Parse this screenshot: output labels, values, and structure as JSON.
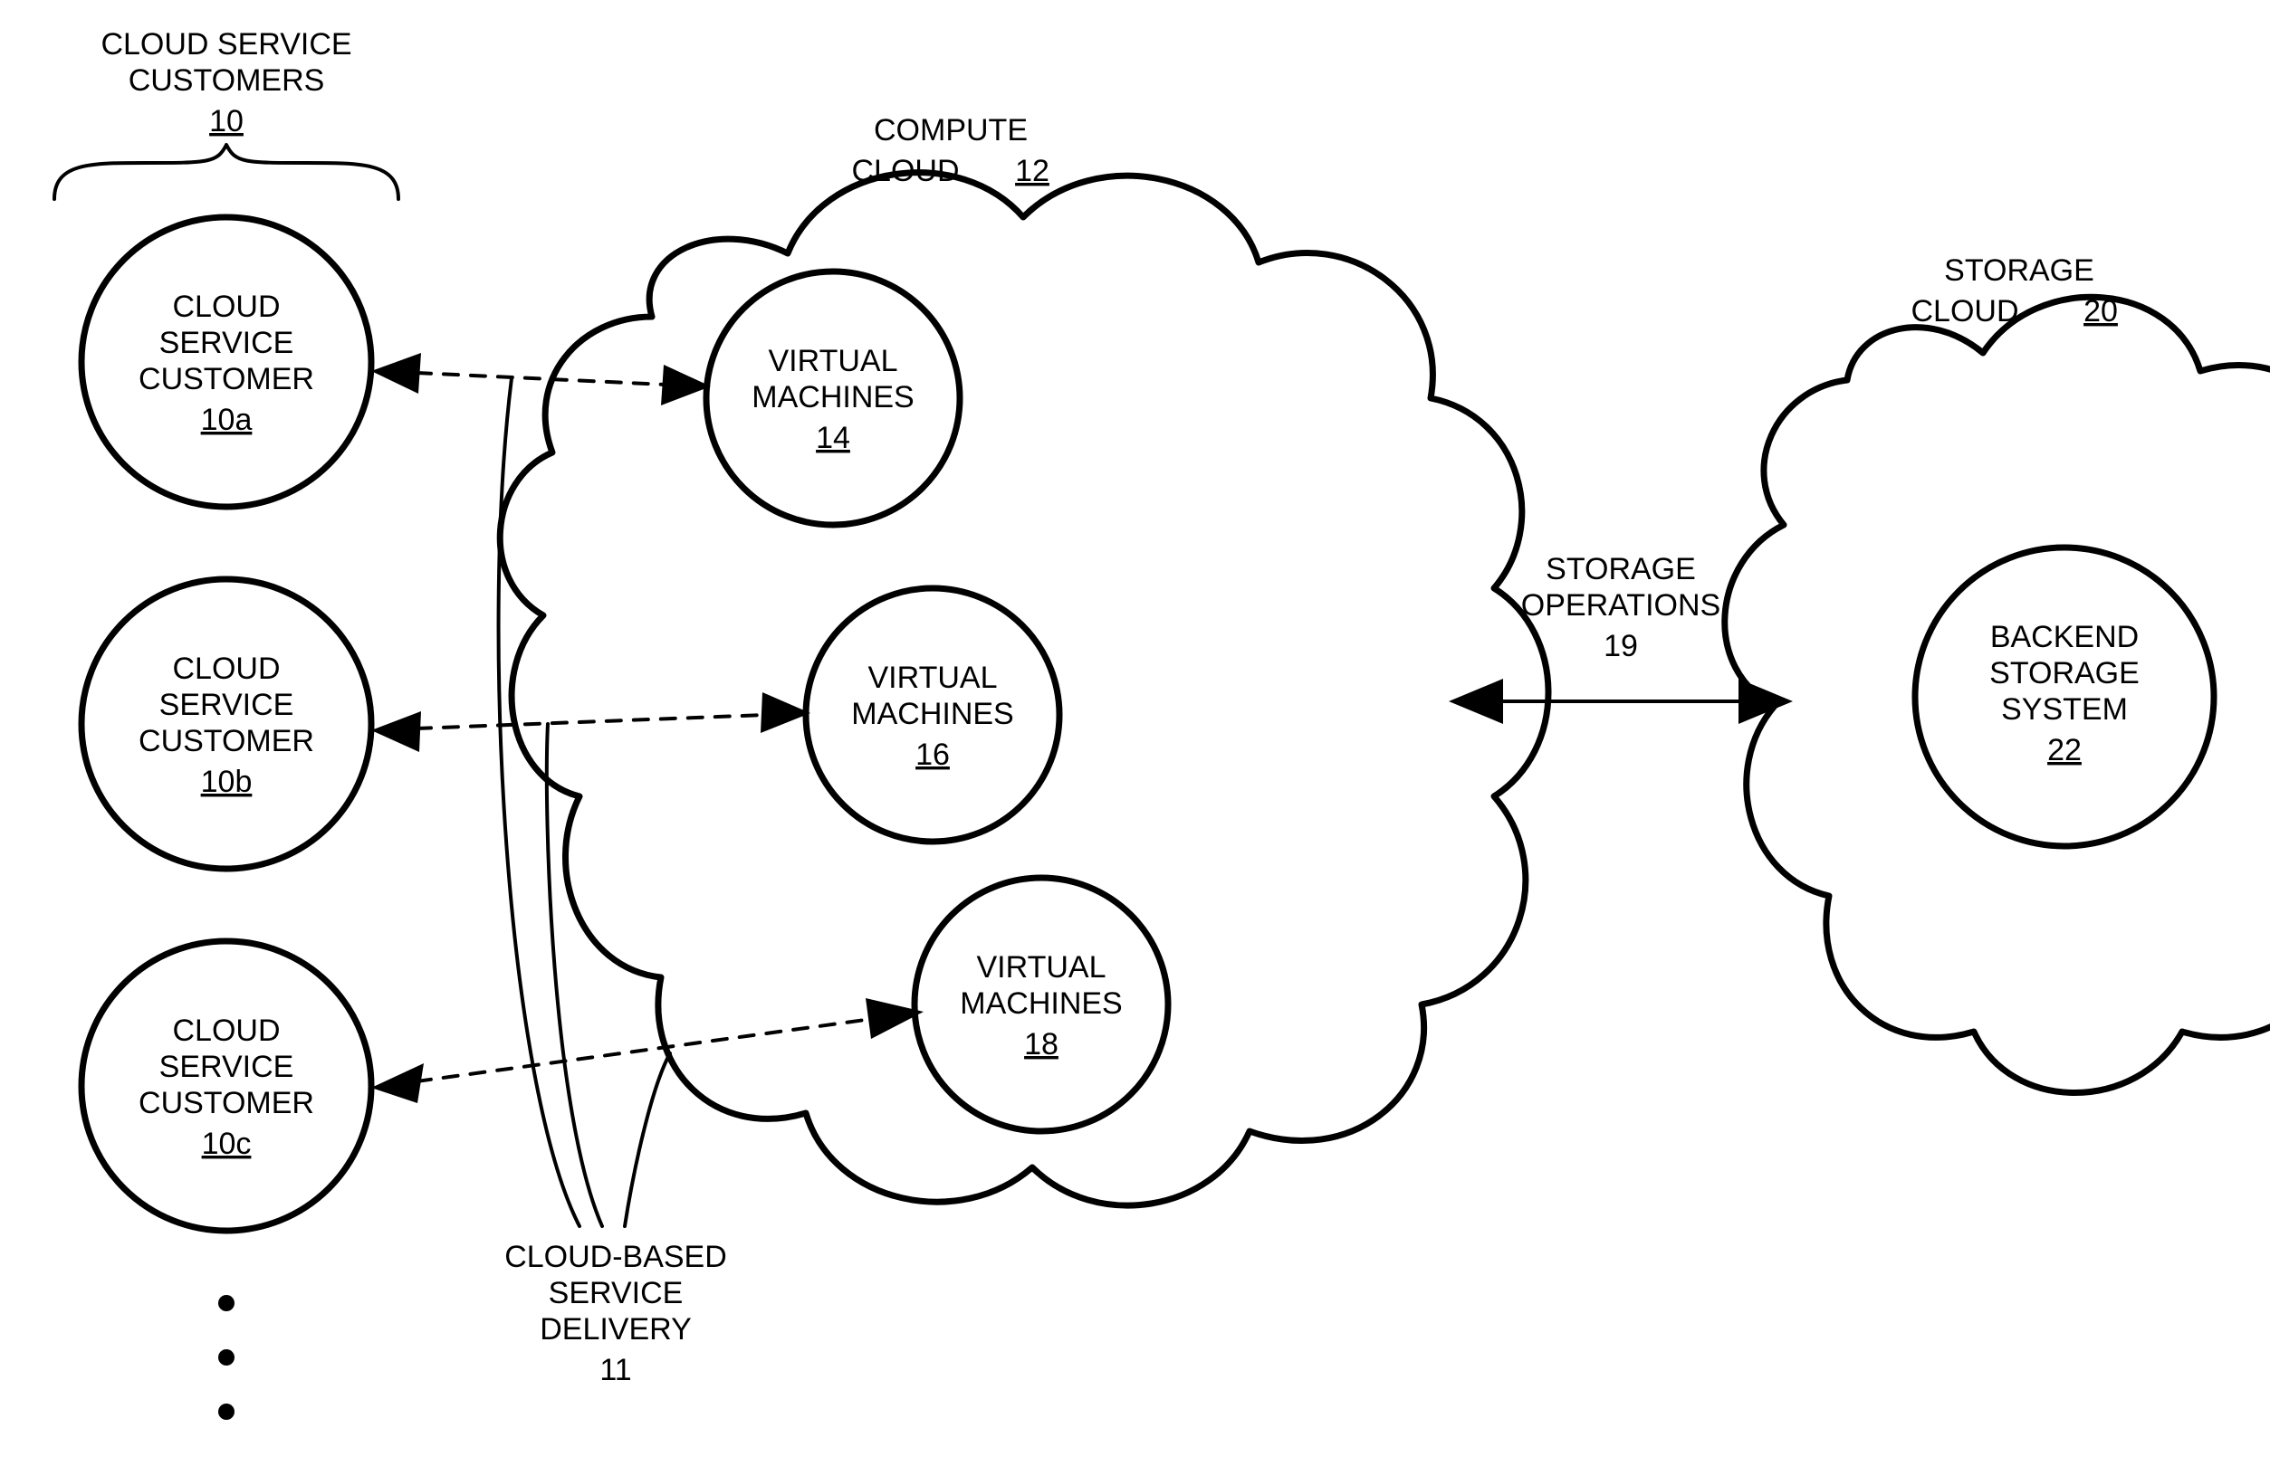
{
  "header": {
    "line1": "CLOUD SERVICE",
    "line2": "CUSTOMERS",
    "ref": "10"
  },
  "customers": [
    {
      "l1": "CLOUD",
      "l2": "SERVICE",
      "l3": "CUSTOMER",
      "ref": "10a"
    },
    {
      "l1": "CLOUD",
      "l2": "SERVICE",
      "l3": "CUSTOMER",
      "ref": "10b"
    },
    {
      "l1": "CLOUD",
      "l2": "SERVICE",
      "l3": "CUSTOMER",
      "ref": "10c"
    }
  ],
  "compute_cloud": {
    "l1": "COMPUTE",
    "l2": "CLOUD",
    "ref": "12"
  },
  "vms": [
    {
      "l1": "VIRTUAL",
      "l2": "MACHINES",
      "ref": "14"
    },
    {
      "l1": "VIRTUAL",
      "l2": "MACHINES",
      "ref": "16"
    },
    {
      "l1": "VIRTUAL",
      "l2": "MACHINES",
      "ref": "18"
    }
  ],
  "delivery": {
    "l1": "CLOUD-BASED",
    "l2": "SERVICE",
    "l3": "DELIVERY",
    "ref": "11"
  },
  "storage_ops": {
    "l1": "STORAGE",
    "l2": "OPERATIONS",
    "ref": "19"
  },
  "storage_cloud": {
    "l1": "STORAGE",
    "l2": "CLOUD",
    "ref": "20"
  },
  "backend": {
    "l1": "BACKEND",
    "l2": "STORAGE",
    "l3": "SYSTEM",
    "ref": "22"
  }
}
